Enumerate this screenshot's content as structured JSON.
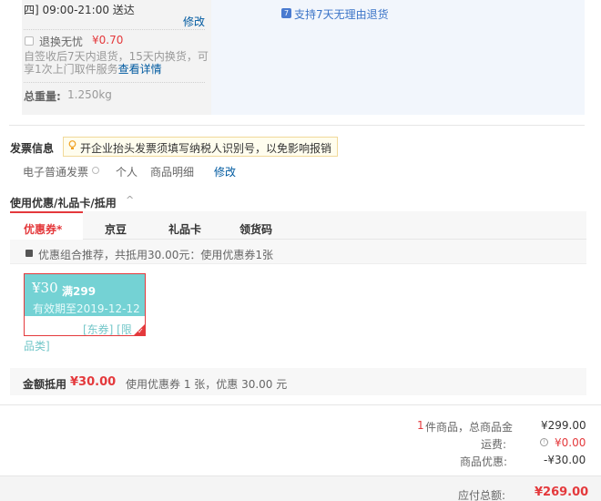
{
  "shipping": {
    "delivery_time": "四] 09:00-21:00 送达",
    "modify": "修改",
    "insurance_label": "退换无忧",
    "insurance_price": "¥0.70",
    "insurance_desc": "自签收后7天内退货，15天内换货，可享1次上门取件服务",
    "insurance_detail": "查看详情",
    "weight_label": "总重量:",
    "weight_value": "1.250kg",
    "return_policy": "支持7天无理由退货"
  },
  "invoice": {
    "title": "发票信息",
    "tip": "开企业抬头发票须填写纳税人识别号，以免影响报销",
    "type": "电子普通发票",
    "person": "个人",
    "content": "商品明细",
    "modify": "修改"
  },
  "coupon": {
    "title": "使用优惠/礼品卡/抵用",
    "toggle": "^",
    "tabs": [
      "优惠券*",
      "京豆",
      "礼品卡",
      "领货码"
    ],
    "combo_text": "优惠组合推荐，共抵用30.00元：使用优惠券1张",
    "card": {
      "amount": "¥30",
      "condition": "满299",
      "expire": "有效期至2019-12-12",
      "tags_line1": "[东券] [限",
      "tags_line2": "品类]"
    },
    "deduct_label": "金额抵用",
    "deduct_amount": "¥30.00",
    "deduct_desc": "使用优惠券 1 张，优惠 30.00 元"
  },
  "summary": {
    "count_num": "1",
    "count_text": "件商品，总商品金",
    "total": "¥299.00",
    "ship_label": "运费:",
    "ship_value": "¥0.00",
    "discount_label": "商品优惠:",
    "discount_value": "-¥30.00",
    "pay_label": "应付总额:",
    "pay_value": "¥269.00"
  },
  "colors": {
    "accent_red": "#e4393c",
    "link_blue": "#005aa0",
    "coupon_teal": "#74d2d4"
  }
}
